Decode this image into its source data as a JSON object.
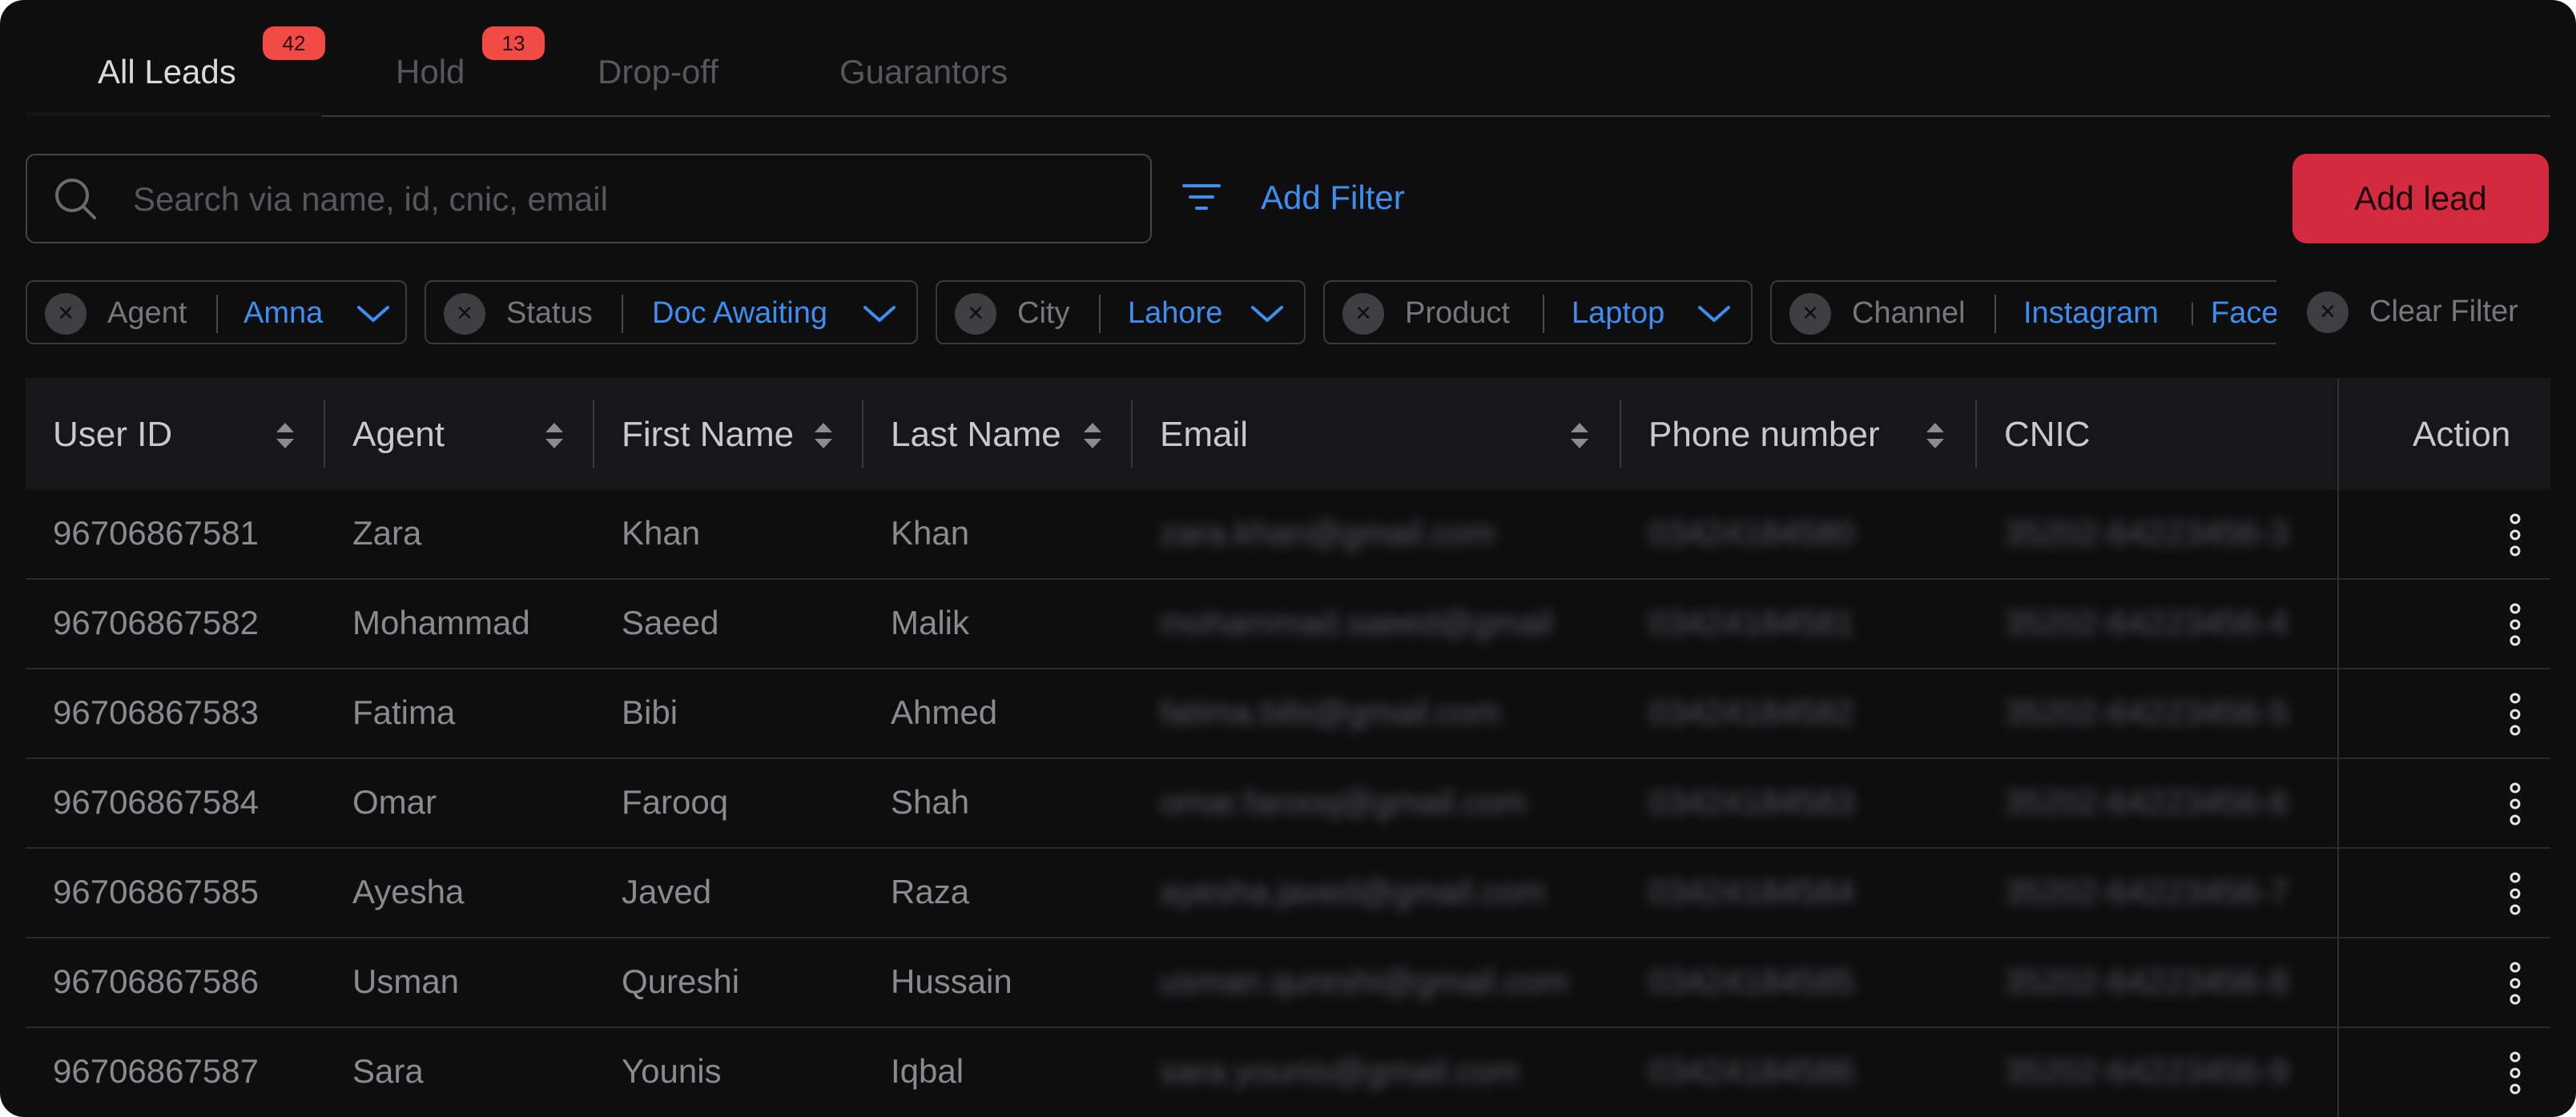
{
  "tabs": [
    {
      "label": "All Leads",
      "badge": "42",
      "active": true
    },
    {
      "label": "Hold",
      "badge": "13",
      "active": false
    },
    {
      "label": "Drop-off",
      "active": false
    },
    {
      "label": "Guarantors",
      "active": false
    }
  ],
  "search": {
    "placeholder": "Search via name, id, cnic, email",
    "value": ""
  },
  "add_filter_label": "Add Filter",
  "add_lead_label": "Add lead",
  "filters": [
    {
      "label": "Agent",
      "value": "Amna"
    },
    {
      "label": "Status",
      "value": "Doc Awaiting"
    },
    {
      "label": "City",
      "value": "Lahore"
    },
    {
      "label": "Product",
      "value": "Laptop"
    },
    {
      "label": "Channel",
      "value": "Instagram",
      "value2": "Facebook"
    }
  ],
  "clear_filter_label": "Clear Filter",
  "table": {
    "columns": [
      "User ID",
      "Agent",
      "First Name",
      "Last Name",
      "Email",
      "Phone number",
      "CNIC",
      "Action"
    ],
    "rows": [
      [
        "96706867581",
        "Zara",
        "Khan",
        "Khan",
        "zara.khan@gmail.com",
        "03424184580",
        "35202-64223456-3"
      ],
      [
        "96706867582",
        "Mohammad",
        "Saeed",
        "Malik",
        "mohammad.saeed@gmail",
        "03424184581",
        "35202-64223456-4"
      ],
      [
        "96706867583",
        "Fatima",
        "Bibi",
        "Ahmed",
        "fatima.bibi@gmail.com",
        "03424184582",
        "35202-64223456-5"
      ],
      [
        "96706867584",
        "Omar",
        "Farooq",
        "Shah",
        "omar.farooq@gmail.com",
        "03424184583",
        "35202-64223456-6"
      ],
      [
        "96706867585",
        "Ayesha",
        "Javed",
        "Raza",
        "ayesha.javed@gmail.com",
        "03424184584",
        "35202-64223456-7"
      ],
      [
        "96706867586",
        "Usman",
        "Qureshi",
        "Hussain",
        "usman.qureshi@gmail.com",
        "03424184585",
        "35202-64223456-8"
      ],
      [
        "96706867587",
        "Sara",
        "Younis",
        "Iqbal",
        "sara.younis@gmail.com",
        "03424184586",
        "35202-64223456-9"
      ]
    ]
  },
  "colors": {
    "background": "#0e0e0f",
    "accent_blue": "#3d8ef0",
    "primary_button": "#d42a40",
    "badge": "#f24a45"
  },
  "icons": {
    "search": "search-icon",
    "filter": "filter-lines-icon",
    "chip_remove": "close-circle-icon",
    "chip_dropdown": "chevron-down-icon",
    "sort": "sort-updown-icon",
    "row_action": "kebab-menu-icon"
  }
}
